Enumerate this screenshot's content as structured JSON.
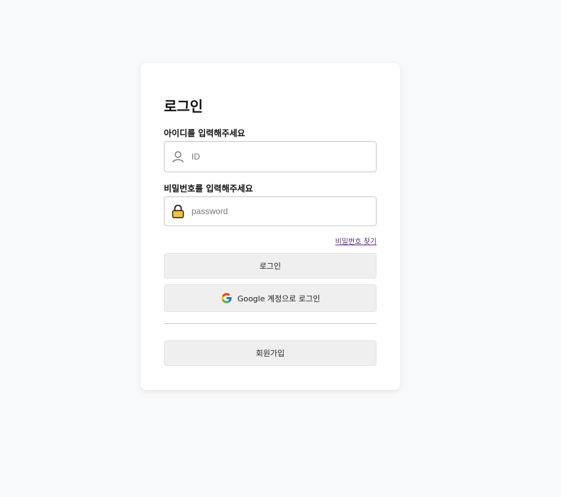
{
  "login": {
    "title": "로그인",
    "id_label": "아이디를 입력해주세요",
    "id_placeholder": "ID",
    "pw_label": "비밀번호를 입력해주세요",
    "pw_placeholder": "password",
    "find_password": "비밀번호 찾기",
    "login_button": "로그인",
    "google_button": "Google 계정으로 로그인",
    "signup_button": "회원가입"
  },
  "icons": {
    "id_icon": "user-icon",
    "pw_icon": "lock-icon",
    "google_icon": "google-logo-icon"
  },
  "colors": {
    "background": "#f8f9fa",
    "card": "#ffffff",
    "button": "#efefef",
    "link": "#5b2a86",
    "lock": "#f5c242"
  }
}
